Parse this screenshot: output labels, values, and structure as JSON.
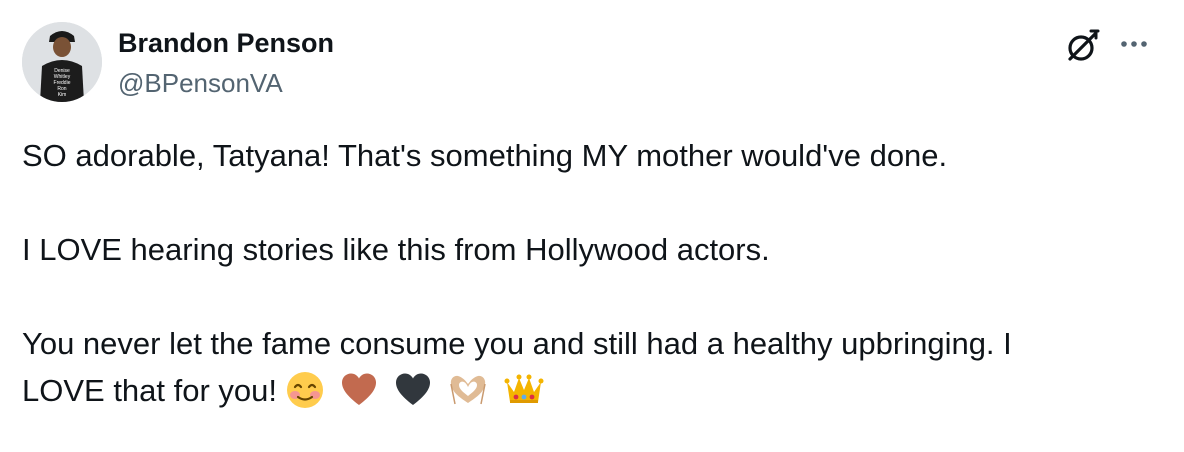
{
  "author": {
    "display_name": "Brandon Penson",
    "handle": "@BPensonVA",
    "avatar_shirt_text": [
      "Denise",
      "Whitley",
      "Freddie",
      "Ron",
      "Kim"
    ]
  },
  "icons": {
    "grok": "grok-icon",
    "more": "more-options-icon"
  },
  "tweet": {
    "line1": "SO adorable, Tatyana! That's something MY mother would've done.",
    "line2": "I LOVE hearing stories like this from Hollywood actors.",
    "line3": "You never let the fame consume you and still had a healthy upbringing. I",
    "line4": "LOVE that for you!",
    "emojis": [
      "smiling-face-with-blush-emoji",
      "brown-heart-emoji",
      "black-heart-emoji",
      "heart-hands-emoji",
      "crown-emoji"
    ]
  },
  "colors": {
    "text": "#0f1419",
    "secondary_text": "#536471",
    "brown_heart": "#c26a4f",
    "black_heart": "#31373d",
    "crown": "#f4b400"
  }
}
